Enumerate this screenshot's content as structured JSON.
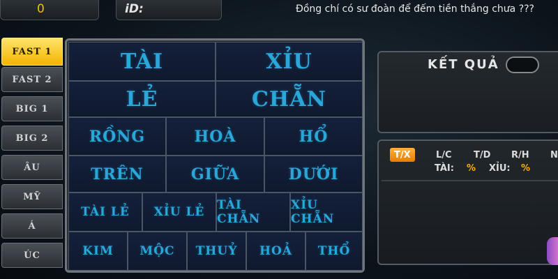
{
  "topbar": {
    "coins": "0",
    "id_label": "iD:",
    "marquee": "Đồng chí có sư đoàn để đếm tiền thắng chưa ???"
  },
  "side_tabs": [
    "FAST 1",
    "FAST 2",
    "BIG 1",
    "BIG 2",
    "ÂU",
    "MỸ",
    "Á",
    "ÚC"
  ],
  "side_active": 0,
  "board": {
    "row1": [
      "TÀI",
      "XỈU"
    ],
    "row2": [
      "LẺ",
      "CHẴN"
    ],
    "row3": [
      "RỒNG",
      "HOÀ",
      "HỔ"
    ],
    "row4": [
      "TRÊN",
      "GIỮA",
      "DƯỚI"
    ],
    "row5": [
      "TÀI LẺ",
      "XỈU LẺ",
      "TÀI CHẴN",
      "XỈU CHẴN"
    ],
    "row6": [
      "KIM",
      "MỘC",
      "THUỶ",
      "HOẢ",
      "THỔ"
    ]
  },
  "result": {
    "title": "KẾT QUẢ"
  },
  "stats": {
    "tabs": [
      "T/X",
      "L/C",
      "T/D",
      "R/H",
      "N"
    ],
    "active": 0,
    "tai_label": "TÀI:",
    "tai_value": "%",
    "xiu_label": "XỈU:",
    "xiu_value": "%"
  },
  "colors": {
    "accent": "#f2b400",
    "cell_text": "#2aa7d8",
    "stat_tab": "#ff9a1a",
    "percent": "#ffb000"
  }
}
